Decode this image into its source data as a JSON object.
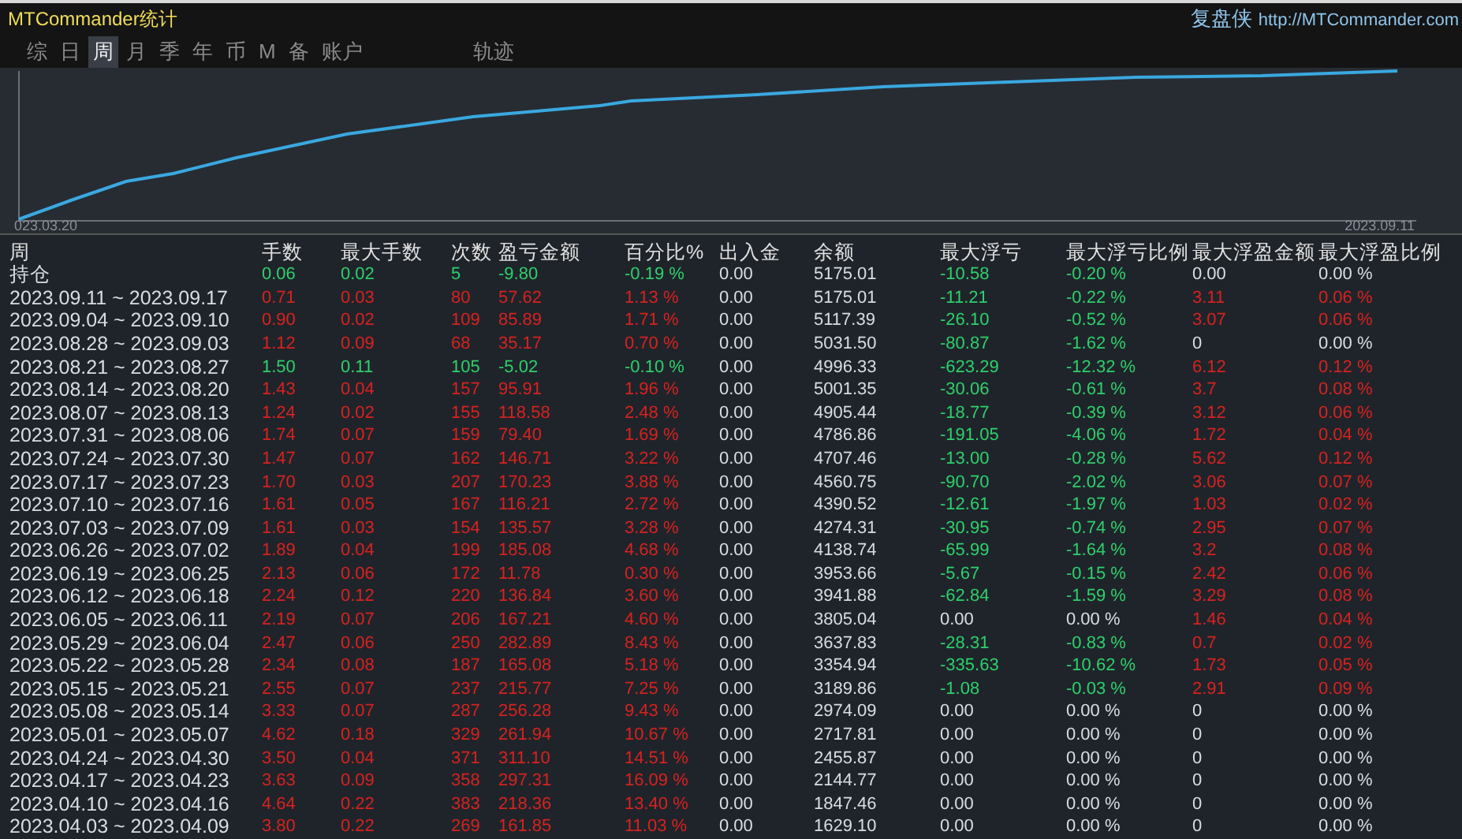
{
  "window": {
    "title": "MTCommander统计",
    "brand": "复盘侠",
    "url": "http://MTCommander.com"
  },
  "tabs": [
    {
      "label": "综",
      "selected": false
    },
    {
      "label": "日",
      "selected": false
    },
    {
      "label": "周",
      "selected": true
    },
    {
      "label": "月",
      "selected": false
    },
    {
      "label": "季",
      "selected": false
    },
    {
      "label": "年",
      "selected": false
    },
    {
      "label": "币",
      "selected": false
    },
    {
      "label": "M",
      "selected": false
    },
    {
      "label": "备",
      "selected": false
    },
    {
      "label": "账户",
      "selected": false
    }
  ],
  "extra_tabs": [
    {
      "label": "轨迹",
      "selected": false
    }
  ],
  "chart": {
    "start_label": "023.03.20",
    "end_label": "2023.09.11"
  },
  "table": {
    "columns": [
      "周",
      "手数",
      "最大手数",
      "次数",
      "盈亏金额",
      "百分比%",
      "出入金",
      "余额",
      "最大浮亏",
      "最大浮亏比例",
      "最大浮盈金额",
      "最大浮盈比例"
    ],
    "rows": [
      {
        "cells": [
          "持仓",
          "0.06",
          "0.02",
          "5",
          "-9.80",
          "-0.19 %",
          "0.00",
          "5175.01",
          "-10.58",
          "-0.20 %",
          "0.00",
          "0.00 %"
        ],
        "gain": false,
        "drawdown": true,
        "floating_profit": false
      },
      {
        "cells": [
          "2023.09.11 ~ 2023.09.17",
          "0.71",
          "0.03",
          "80",
          "57.62",
          "1.13 %",
          "0.00",
          "5175.01",
          "-11.21",
          "-0.22 %",
          "3.11",
          "0.06 %"
        ],
        "gain": true,
        "drawdown": true,
        "floating_profit": true
      },
      {
        "cells": [
          "2023.09.04 ~ 2023.09.10",
          "0.90",
          "0.02",
          "109",
          "85.89",
          "1.71 %",
          "0.00",
          "5117.39",
          "-26.10",
          "-0.52 %",
          "3.07",
          "0.06 %"
        ],
        "gain": true,
        "drawdown": true,
        "floating_profit": true
      },
      {
        "cells": [
          "2023.08.28 ~ 2023.09.03",
          "1.12",
          "0.09",
          "68",
          "35.17",
          "0.70 %",
          "0.00",
          "5031.50",
          "-80.87",
          "-1.62 %",
          "0",
          "0.00 %"
        ],
        "gain": true,
        "drawdown": true,
        "floating_profit": false
      },
      {
        "cells": [
          "2023.08.21 ~ 2023.08.27",
          "1.50",
          "0.11",
          "105",
          "-5.02",
          "-0.10 %",
          "0.00",
          "4996.33",
          "-623.29",
          "-12.32 %",
          "6.12",
          "0.12 %"
        ],
        "gain": false,
        "drawdown": true,
        "floating_profit": true
      },
      {
        "cells": [
          "2023.08.14 ~ 2023.08.20",
          "1.43",
          "0.04",
          "157",
          "95.91",
          "1.96 %",
          "0.00",
          "5001.35",
          "-30.06",
          "-0.61 %",
          "3.7",
          "0.08 %"
        ],
        "gain": true,
        "drawdown": true,
        "floating_profit": true
      },
      {
        "cells": [
          "2023.08.07 ~ 2023.08.13",
          "1.24",
          "0.02",
          "155",
          "118.58",
          "2.48 %",
          "0.00",
          "4905.44",
          "-18.77",
          "-0.39 %",
          "3.12",
          "0.06 %"
        ],
        "gain": true,
        "drawdown": true,
        "floating_profit": true
      },
      {
        "cells": [
          "2023.07.31 ~ 2023.08.06",
          "1.74",
          "0.07",
          "159",
          "79.40",
          "1.69 %",
          "0.00",
          "4786.86",
          "-191.05",
          "-4.06 %",
          "1.72",
          "0.04 %"
        ],
        "gain": true,
        "drawdown": true,
        "floating_profit": true
      },
      {
        "cells": [
          "2023.07.24 ~ 2023.07.30",
          "1.47",
          "0.07",
          "162",
          "146.71",
          "3.22 %",
          "0.00",
          "4707.46",
          "-13.00",
          "-0.28 %",
          "5.62",
          "0.12 %"
        ],
        "gain": true,
        "drawdown": true,
        "floating_profit": true
      },
      {
        "cells": [
          "2023.07.17 ~ 2023.07.23",
          "1.70",
          "0.03",
          "207",
          "170.23",
          "3.88 %",
          "0.00",
          "4560.75",
          "-90.70",
          "-2.02 %",
          "3.06",
          "0.07 %"
        ],
        "gain": true,
        "drawdown": true,
        "floating_profit": true
      },
      {
        "cells": [
          "2023.07.10 ~ 2023.07.16",
          "1.61",
          "0.05",
          "167",
          "116.21",
          "2.72 %",
          "0.00",
          "4390.52",
          "-12.61",
          "-1.97 %",
          "1.03",
          "0.02 %"
        ],
        "gain": true,
        "drawdown": true,
        "floating_profit": true
      },
      {
        "cells": [
          "2023.07.03 ~ 2023.07.09",
          "1.61",
          "0.03",
          "154",
          "135.57",
          "3.28 %",
          "0.00",
          "4274.31",
          "-30.95",
          "-0.74 %",
          "2.95",
          "0.07 %"
        ],
        "gain": true,
        "drawdown": true,
        "floating_profit": true
      },
      {
        "cells": [
          "2023.06.26 ~ 2023.07.02",
          "1.89",
          "0.04",
          "199",
          "185.08",
          "4.68 %",
          "0.00",
          "4138.74",
          "-65.99",
          "-1.64 %",
          "3.2",
          "0.08 %"
        ],
        "gain": true,
        "drawdown": true,
        "floating_profit": true
      },
      {
        "cells": [
          "2023.06.19 ~ 2023.06.25",
          "2.13",
          "0.06",
          "172",
          "11.78",
          "0.30 %",
          "0.00",
          "3953.66",
          "-5.67",
          "-0.15 %",
          "2.42",
          "0.06 %"
        ],
        "gain": true,
        "drawdown": true,
        "floating_profit": true
      },
      {
        "cells": [
          "2023.06.12 ~ 2023.06.18",
          "2.24",
          "0.12",
          "220",
          "136.84",
          "3.60 %",
          "0.00",
          "3941.88",
          "-62.84",
          "-1.59 %",
          "3.29",
          "0.08 %"
        ],
        "gain": true,
        "drawdown": true,
        "floating_profit": true
      },
      {
        "cells": [
          "2023.06.05 ~ 2023.06.11",
          "2.19",
          "0.07",
          "206",
          "167.21",
          "4.60 %",
          "0.00",
          "3805.04",
          "0.00",
          "0.00 %",
          "1.46",
          "0.04 %"
        ],
        "gain": true,
        "drawdown": false,
        "floating_profit": true
      },
      {
        "cells": [
          "2023.05.29 ~ 2023.06.04",
          "2.47",
          "0.06",
          "250",
          "282.89",
          "8.43 %",
          "0.00",
          "3637.83",
          "-28.31",
          "-0.83 %",
          "0.7",
          "0.02 %"
        ],
        "gain": true,
        "drawdown": true,
        "floating_profit": true
      },
      {
        "cells": [
          "2023.05.22 ~ 2023.05.28",
          "2.34",
          "0.08",
          "187",
          "165.08",
          "5.18 %",
          "0.00",
          "3354.94",
          "-335.63",
          "-10.62 %",
          "1.73",
          "0.05 %"
        ],
        "gain": true,
        "drawdown": true,
        "floating_profit": true
      },
      {
        "cells": [
          "2023.05.15 ~ 2023.05.21",
          "2.55",
          "0.07",
          "237",
          "215.77",
          "7.25 %",
          "0.00",
          "3189.86",
          "-1.08",
          "-0.03 %",
          "2.91",
          "0.09 %"
        ],
        "gain": true,
        "drawdown": true,
        "floating_profit": true
      },
      {
        "cells": [
          "2023.05.08 ~ 2023.05.14",
          "3.33",
          "0.07",
          "287",
          "256.28",
          "9.43 %",
          "0.00",
          "2974.09",
          "0.00",
          "0.00 %",
          "0",
          "0.00 %"
        ],
        "gain": true,
        "drawdown": false,
        "floating_profit": false
      },
      {
        "cells": [
          "2023.05.01 ~ 2023.05.07",
          "4.62",
          "0.18",
          "329",
          "261.94",
          "10.67 %",
          "0.00",
          "2717.81",
          "0.00",
          "0.00 %",
          "0",
          "0.00 %"
        ],
        "gain": true,
        "drawdown": false,
        "floating_profit": false
      },
      {
        "cells": [
          "2023.04.24 ~ 2023.04.30",
          "3.50",
          "0.04",
          "371",
          "311.10",
          "14.51 %",
          "0.00",
          "2455.87",
          "0.00",
          "0.00 %",
          "0",
          "0.00 %"
        ],
        "gain": true,
        "drawdown": false,
        "floating_profit": false
      },
      {
        "cells": [
          "2023.04.17 ~ 2023.04.23",
          "3.63",
          "0.09",
          "358",
          "297.31",
          "16.09 %",
          "0.00",
          "2144.77",
          "0.00",
          "0.00 %",
          "0",
          "0.00 %"
        ],
        "gain": true,
        "drawdown": false,
        "floating_profit": false
      },
      {
        "cells": [
          "2023.04.10 ~ 2023.04.16",
          "4.64",
          "0.22",
          "383",
          "218.36",
          "13.40 %",
          "0.00",
          "1847.46",
          "0.00",
          "0.00 %",
          "0",
          "0.00 %"
        ],
        "gain": true,
        "drawdown": false,
        "floating_profit": false
      },
      {
        "cells": [
          "2023.04.03 ~ 2023.04.09",
          "3.80",
          "0.22",
          "269",
          "161.85",
          "11.03 %",
          "0.00",
          "1629.10",
          "0.00",
          "0.00 %",
          "0",
          "0.00 %"
        ],
        "gain": true,
        "drawdown": false,
        "floating_profit": false
      }
    ]
  }
}
